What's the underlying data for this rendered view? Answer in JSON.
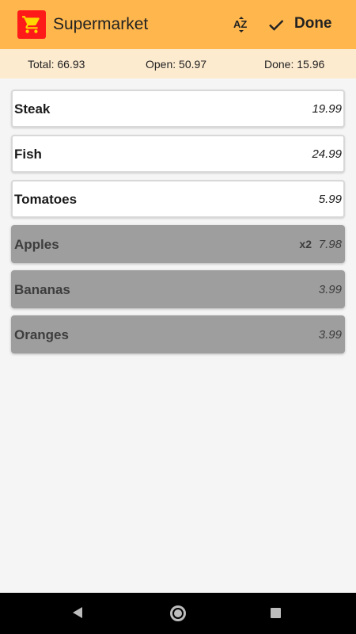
{
  "appbar": {
    "title": "Supermarket",
    "sort_icon": "sort-az-icon",
    "check_icon": "check-icon",
    "done_label": "Done",
    "accent": "#ffb74d",
    "brand_icon_color": "#ff1a1a"
  },
  "summary": {
    "total": "Total: 66.93",
    "open": "Open: 50.97",
    "done": "Done: 15.96"
  },
  "items": [
    {
      "name": "Steak",
      "price": "19.99",
      "qty": "",
      "status": "open"
    },
    {
      "name": "Fish",
      "price": "24.99",
      "qty": "",
      "status": "open"
    },
    {
      "name": "Tomatoes",
      "price": "5.99",
      "qty": "",
      "status": "open"
    },
    {
      "name": "Apples",
      "price": "7.98",
      "qty": "x2",
      "status": "done"
    },
    {
      "name": "Bananas",
      "price": "3.99",
      "qty": "",
      "status": "done"
    },
    {
      "name": "Oranges",
      "price": "3.99",
      "qty": "",
      "status": "done"
    }
  ],
  "navbar": {
    "back_icon": "back-icon",
    "home_icon": "home-icon",
    "recents_icon": "recents-icon"
  }
}
